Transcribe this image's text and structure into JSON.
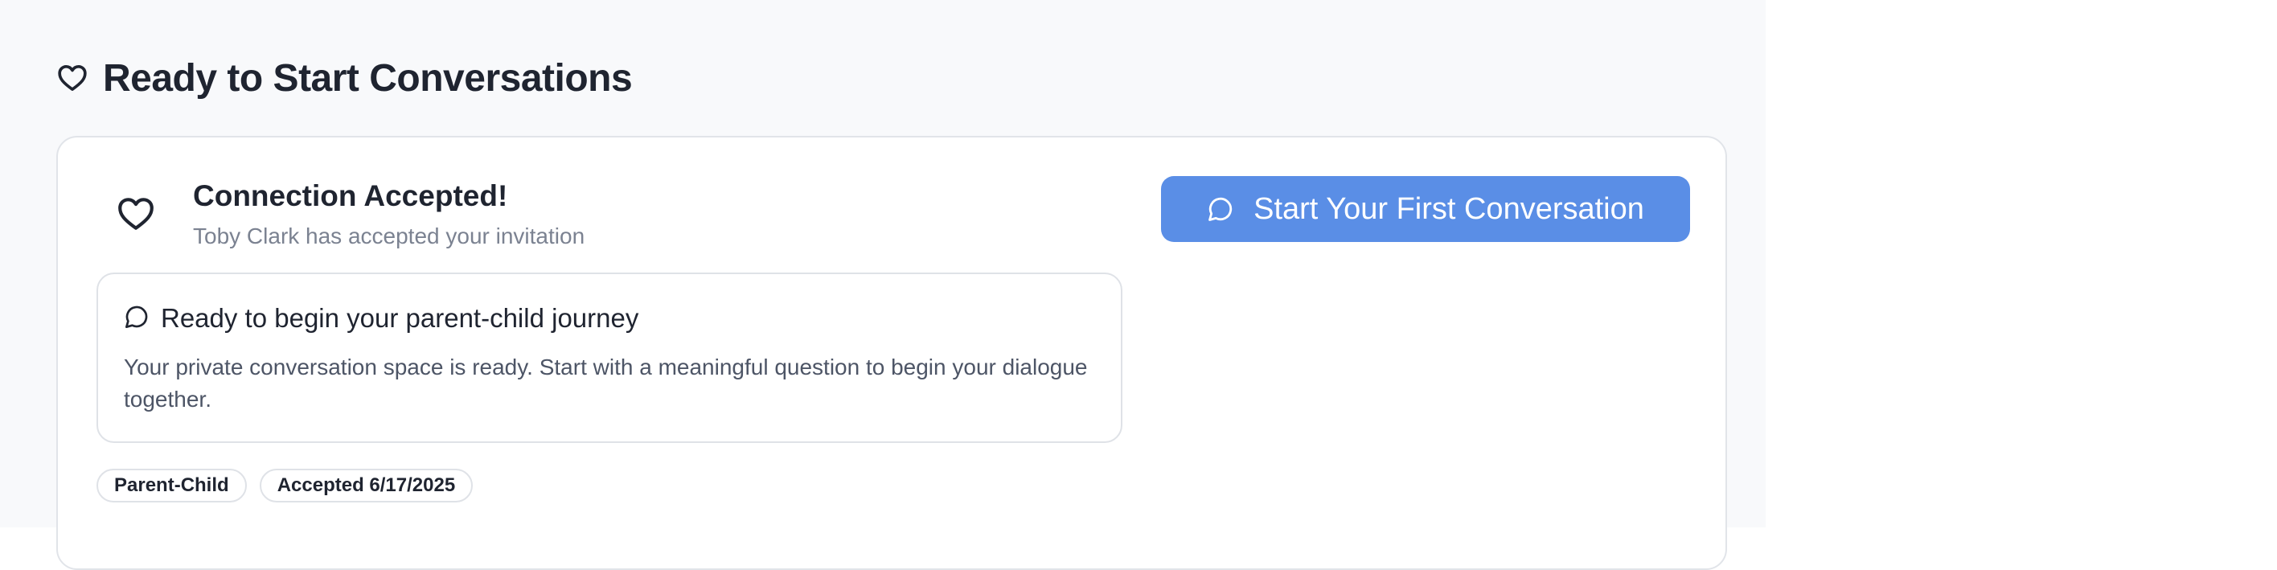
{
  "section": {
    "title": "Ready to Start Conversations",
    "icon": "heart-icon"
  },
  "connection": {
    "icon": "heart-icon",
    "title": "Connection Accepted!",
    "subtitle": "Toby Clark has accepted your invitation"
  },
  "start_button": {
    "icon": "chat-bubble-icon",
    "label": "Start Your First Conversation"
  },
  "info_box": {
    "icon": "chat-bubble-icon",
    "heading": "Ready to begin your parent-child journey",
    "body": "Your private conversation space is ready. Start with a meaningful question to begin your dialogue together."
  },
  "tags": [
    {
      "label": "Parent-Child"
    },
    {
      "label": "Accepted 6/17/2025"
    }
  ],
  "colors": {
    "accent": "#5a8ee6",
    "text_primary": "#1f2430",
    "text_muted": "#7b8291",
    "page_background": "#f8f9fb",
    "border": "#e1e4e9"
  }
}
